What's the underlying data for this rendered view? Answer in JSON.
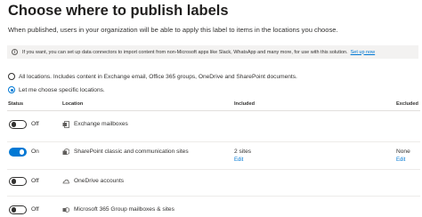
{
  "page": {
    "title": "Choose where to publish labels",
    "description": "When published, users in your organization will be able to apply this label to items in the locations you choose."
  },
  "info_bar": {
    "text": "If you want, you can set up data connectors to import content from non-Microsoft apps like Slack, WhatsApp and many more, for use with this solution.",
    "link_label": "Set up now"
  },
  "scope_options": [
    {
      "label": "All locations. Includes content in Exchange email, Office 365 groups, OneDrive and SharePoint documents.",
      "selected": false
    },
    {
      "label": "Let me choose specific locations.",
      "selected": true
    }
  ],
  "table": {
    "columns": {
      "status": "Status",
      "location": "Location",
      "included": "Included",
      "excluded": "Excluded"
    },
    "rows": [
      {
        "status_label": "Off",
        "enabled": false,
        "location": "Exchange mailboxes",
        "icon": "exchange-icon",
        "included": "",
        "included_edit": "",
        "excluded": "",
        "excluded_edit": ""
      },
      {
        "status_label": "On",
        "enabled": true,
        "location": "SharePoint classic and communication sites",
        "icon": "sharepoint-icon",
        "included": "2 sites",
        "included_edit": "Edit",
        "excluded": "None",
        "excluded_edit": "Edit"
      },
      {
        "status_label": "Off",
        "enabled": false,
        "location": "OneDrive accounts",
        "icon": "onedrive-icon",
        "included": "",
        "included_edit": "",
        "excluded": "",
        "excluded_edit": ""
      },
      {
        "status_label": "Off",
        "enabled": false,
        "location": "Microsoft 365 Group mailboxes & sites",
        "icon": "group-icon",
        "included": "",
        "included_edit": "",
        "excluded": "",
        "excluded_edit": ""
      }
    ]
  },
  "colors": {
    "accent": "#0078d4",
    "info_background": "#f3f2f1",
    "text": "#323130"
  }
}
